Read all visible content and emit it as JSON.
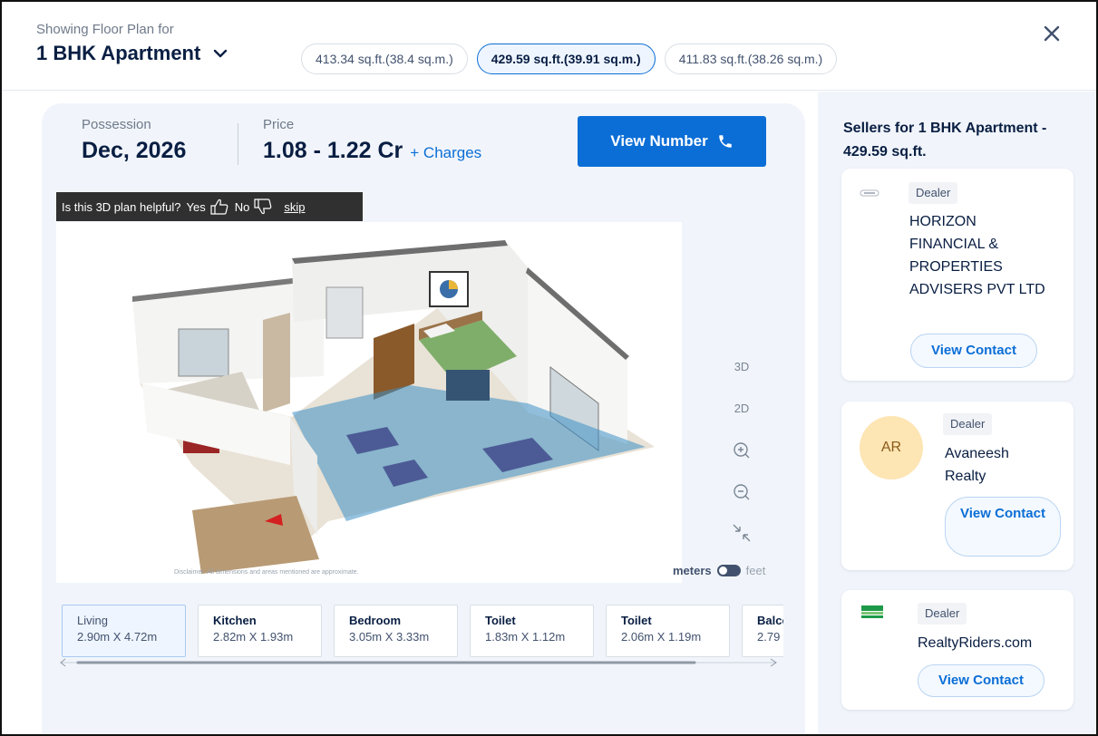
{
  "header": {
    "eyebrow": "Showing Floor Plan for",
    "config": "1 BHK Apartment",
    "sizes": [
      {
        "label": "413.34 sq.ft.(38.4 sq.m.)",
        "active": false
      },
      {
        "label": "429.59 sq.ft.(39.91 sq.m.)",
        "active": true
      },
      {
        "label": "411.83 sq.ft.(38.26 sq.m.)",
        "active": false
      }
    ]
  },
  "summary": {
    "possession_label": "Possession",
    "possession_value": "Dec, 2026",
    "price_label": "Price",
    "price_value": "1.08 - 1.22 Cr",
    "charges": "+ Charges",
    "view_number": "View Number"
  },
  "feedback": {
    "question": "Is this 3D plan helpful?",
    "yes": "Yes",
    "no": "No",
    "skip": "skip"
  },
  "viewer": {
    "disclaimer": "Disclaimer: All dimensions and areas mentioned are approximate.",
    "controls": {
      "three_d": "3D",
      "two_d": "2D"
    },
    "units": {
      "meters": "meters",
      "feet": "feet",
      "selected": "meters"
    }
  },
  "rooms": [
    {
      "name": "Living",
      "dims": "2.90m X 4.72m",
      "active": true
    },
    {
      "name": "Kitchen",
      "dims": "2.82m X 1.93m",
      "active": false
    },
    {
      "name": "Bedroom",
      "dims": "3.05m X 3.33m",
      "active": false
    },
    {
      "name": "Toilet",
      "dims": "1.83m X 1.12m",
      "active": false
    },
    {
      "name": "Toilet",
      "dims": "2.06m X 1.19m",
      "active": false
    },
    {
      "name": "Balcony",
      "dims": "2.79",
      "active": false
    }
  ],
  "sellers": {
    "title": "Sellers for 1 BHK Apartment - 429.59 sq.ft.",
    "items": [
      {
        "type": "Dealer",
        "name": "HORIZON FINANCIAL & PROPERTIES ADVISERS PVT LTD",
        "contact": "View Contact"
      },
      {
        "type": "Dealer",
        "name": "Avaneesh Realty",
        "initials": "AR",
        "contact": "View Contact"
      },
      {
        "type": "Dealer",
        "name": "RealtyRiders.com",
        "contact": "View Contact"
      }
    ]
  },
  "colors": {
    "accent": "#0b6ed6",
    "panel_bg": "#f1f5fb",
    "avatar_bg": "#fde5b4"
  }
}
